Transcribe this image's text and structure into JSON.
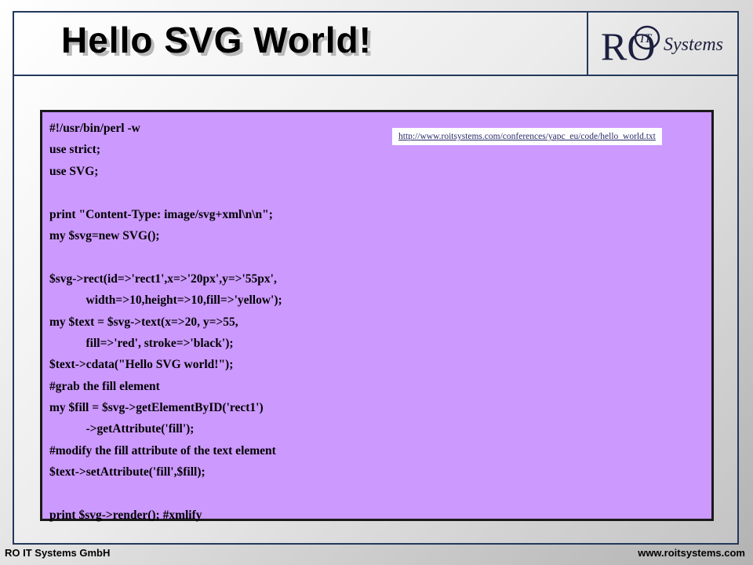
{
  "slide": {
    "title": "Hello SVG World!"
  },
  "logo": {
    "letters": "RO",
    "circle_text": "IT",
    "wordmark": "Systems"
  },
  "code": {
    "lines": [
      "#!/usr/bin/perl -w",
      "use strict;",
      "use SVG;",
      "",
      "print \"Content-Type: image/svg+xml\\n\\n\";",
      "my $svg=new SVG();",
      "",
      "$svg->rect(id=>'rect1',x=>'20px',y=>'55px',",
      "            width=>10,height=>10,fill=>'yellow');",
      "my $text = $svg->text(x=>20, y=>55,",
      "            fill=>'red', stroke=>'black');",
      "$text->cdata(\"Hello SVG world!\");",
      "#grab the fill element",
      "my $fill = $svg->getElementByID('rect1')",
      "            ->getAttribute('fill');",
      "#modify the fill attribute of the text element",
      "$text->setAttribute('fill',$fill);",
      "",
      "print $svg->render(); #xmlify"
    ],
    "url": "http://www.roitsystems.com/conferences/yapc_eu/code/hello_world.txt"
  },
  "footer": {
    "company": "RO IT Systems GmbH",
    "website": "www.roitsystems.com"
  },
  "colors": {
    "code_background": "#cc99ff",
    "frame_border": "#23395b"
  }
}
